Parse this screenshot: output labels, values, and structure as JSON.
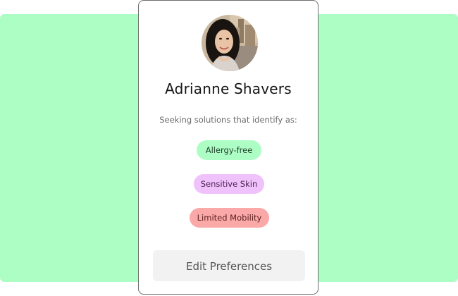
{
  "profile": {
    "name": "Adrianne Shavers",
    "subtitle": "Seeking solutions that identify as:"
  },
  "tags": [
    {
      "label": "Allergy-free",
      "color": "#adfec4"
    },
    {
      "label": "Sensitive Skin",
      "color": "#f0c2fb"
    },
    {
      "label": "Limited Mobility",
      "color": "#fba8a8"
    }
  ],
  "actions": {
    "edit_label": "Edit Preferences"
  },
  "colors": {
    "background_panel": "#adfec4",
    "card_border": "#6d6d6d",
    "button_bg": "#f2f2f2"
  }
}
